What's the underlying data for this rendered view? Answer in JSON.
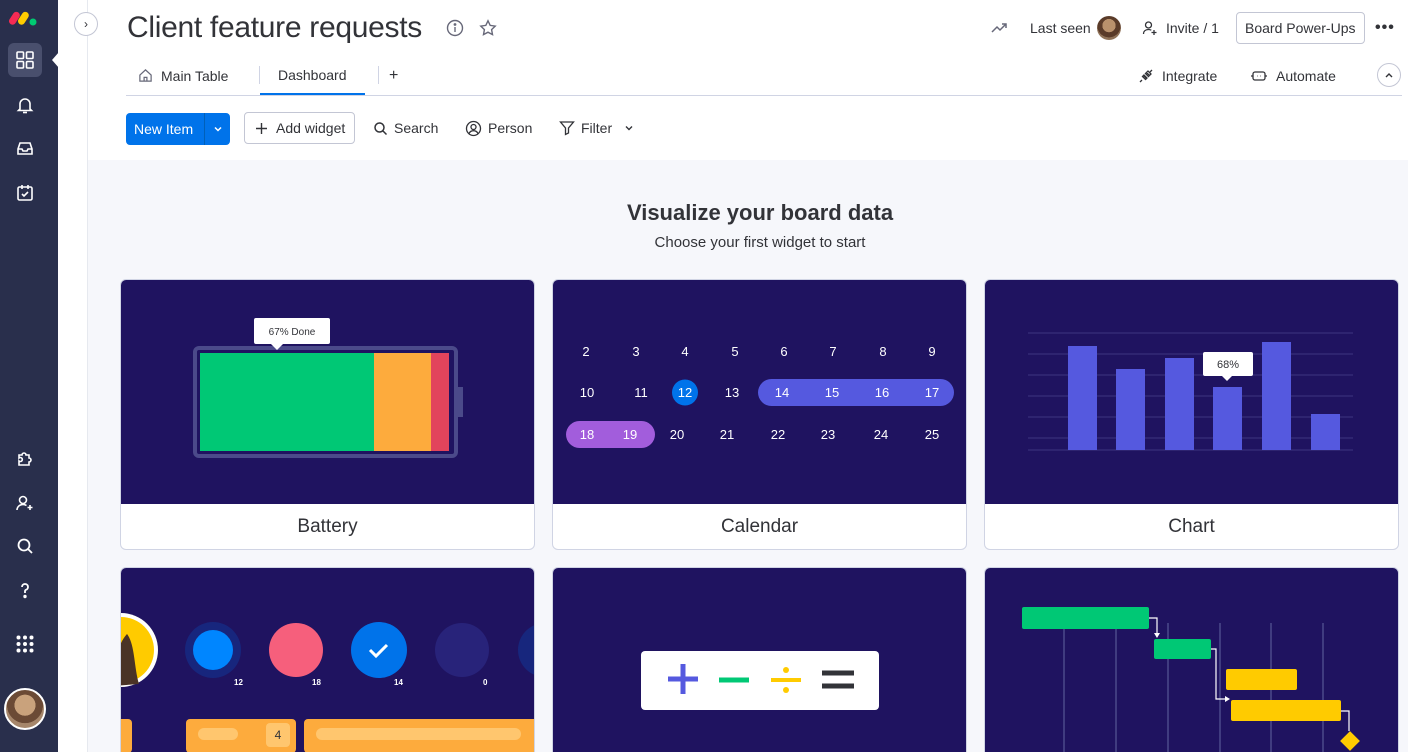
{
  "board": {
    "title": "Client feature requests",
    "last_seen_label": "Last seen",
    "invite_label": "Invite / 1",
    "power_ups_label": "Board Power-Ups",
    "more_label": "•••"
  },
  "tabs": [
    {
      "label": "Main Table",
      "icon": "home-icon"
    },
    {
      "label": "Dashboard",
      "active": true
    },
    {
      "label": "+"
    }
  ],
  "tab_actions": {
    "integrate_label": "Integrate",
    "automate_label": "Automate"
  },
  "toolbar": {
    "new_item_label": "New Item",
    "add_widget_label": "Add widget",
    "search_label": "Search",
    "person_label": "Person",
    "filter_label": "Filter"
  },
  "empty_state": {
    "heading": "Visualize your board data",
    "subheading": "Choose your first widget to start"
  },
  "widgets": [
    {
      "label": "Battery",
      "tooltip": "67% Done"
    },
    {
      "label": "Calendar",
      "days_row1": [
        "2",
        "3",
        "4",
        "5",
        "6",
        "7",
        "8",
        "9"
      ],
      "days_row2": [
        "10",
        "11",
        "12",
        "13",
        "14",
        "15",
        "16",
        "17"
      ],
      "days_row3": [
        "18",
        "19",
        "20",
        "21",
        "22",
        "23",
        "24",
        "25"
      ],
      "today": "12"
    },
    {
      "label": "Chart",
      "tooltip": "68%"
    },
    {
      "label": "",
      "counts": [
        "12",
        "18",
        "14",
        "0"
      ],
      "bar_value": "4"
    },
    {
      "label": "",
      "symbols": [
        "+",
        "−",
        "÷",
        "="
      ]
    },
    {
      "label": ""
    }
  ],
  "colors": {
    "rail": "#292f4c",
    "primary": "#0073ea",
    "widget_bg": "#1f1360",
    "bar": "#5559df",
    "green": "#00c875",
    "orange": "#fdab3d",
    "red": "#e2445c",
    "yellow": "#ffcb00",
    "purple": "#a25ddc"
  }
}
